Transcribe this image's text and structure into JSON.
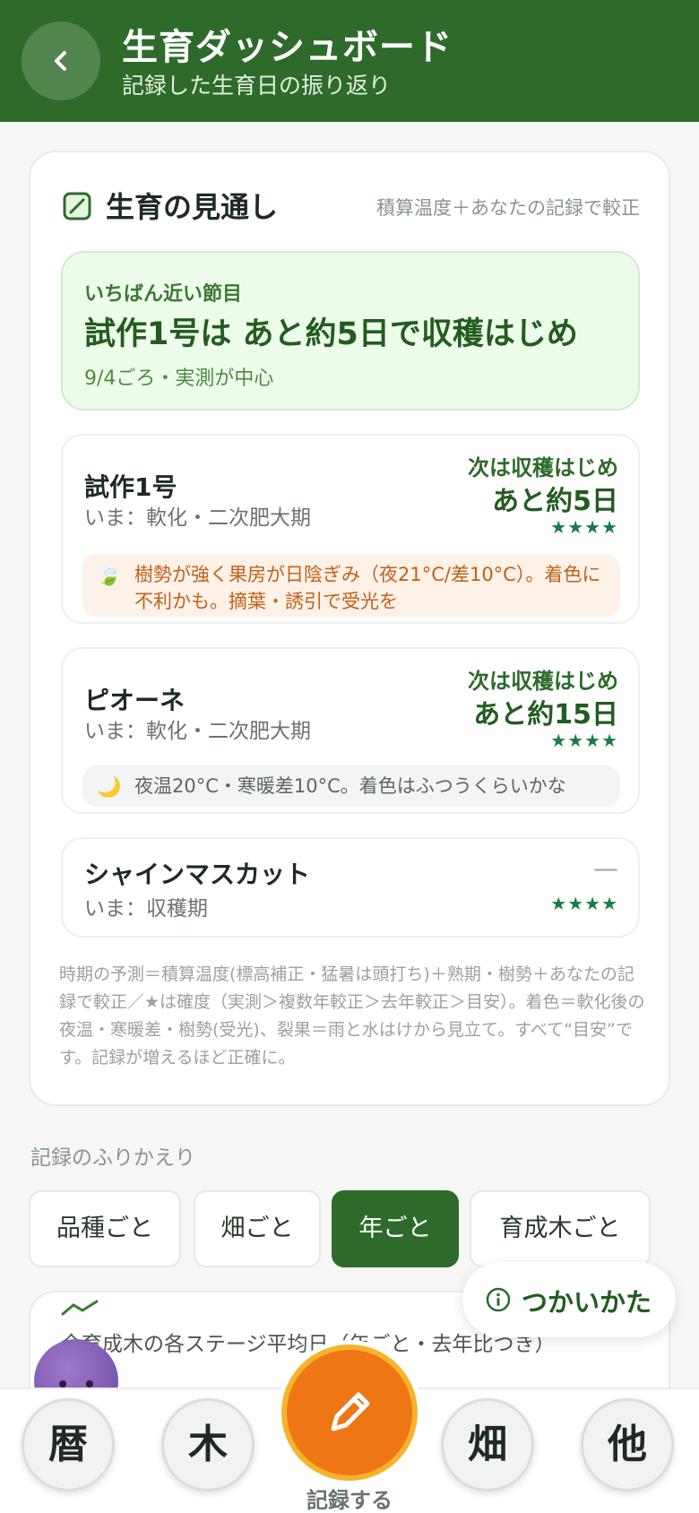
{
  "header": {
    "title": "生育ダッシュボード",
    "subtitle": "記録した生育日の振り返り"
  },
  "outlook": {
    "title": "生育の見通し",
    "note": "積算温度＋あなたの記録で較正",
    "highlight": {
      "label": "いちばん近い節目",
      "main": "試作1号は あと約5日で収穫はじめ",
      "sub": "9/4ごろ・実測が中心"
    },
    "varieties": [
      {
        "name": "試作1号",
        "stage": "いま：軟化・二次肥大期",
        "next": "次は収穫はじめ",
        "days": "あと約5日",
        "stars": "★★★★",
        "note_icon": "🍃",
        "note": "樹勢が強く果房が日陰ぎみ（夜21°C/差10°C）。着色に不利かも。摘葉・誘引で受光を"
      },
      {
        "name": "ピオーネ",
        "stage": "いま：軟化・二次肥大期",
        "next": "次は収穫はじめ",
        "days": "あと約15日",
        "stars": "★★★★",
        "note_icon": "🌙",
        "note": "夜温20°C・寒暖差10°C。着色はふつうくらいかな"
      },
      {
        "name": "シャインマスカット",
        "stage": "いま：収穫期",
        "next": "—",
        "stars": "★★★★"
      }
    ],
    "footnote": "時期の予測＝積算温度(標高補正・猛暑は頭打ち)＋熟期・樹勢＋あなたの記録で較正／★は確度（実測＞複数年較正＞去年較正＞目安）。着色＝軟化後の夜温・寒暖差・樹勢(受光)、裂果＝雨と水はけから見立て。すべて“目安”です。記録が増えるほど正確に。"
  },
  "review": {
    "label": "記録のふりかえり",
    "tabs": [
      "品種ごと",
      "畑ごと",
      "年ごと",
      "育成木ごと"
    ],
    "active_tab": "年ごと",
    "card_title": "全育成木の各ステージ平均日（年ごと・去年比つき）"
  },
  "help": {
    "label": "つかいかた",
    "icon": "info-icon"
  },
  "bottom_nav": {
    "items": [
      "暦",
      "木",
      "畑",
      "他"
    ],
    "record_label": "記録する"
  },
  "colors": {
    "primary": "#2e6b2b",
    "accent": "#ee7614",
    "star": "#1b7a45",
    "warn_text": "#c0611a"
  }
}
